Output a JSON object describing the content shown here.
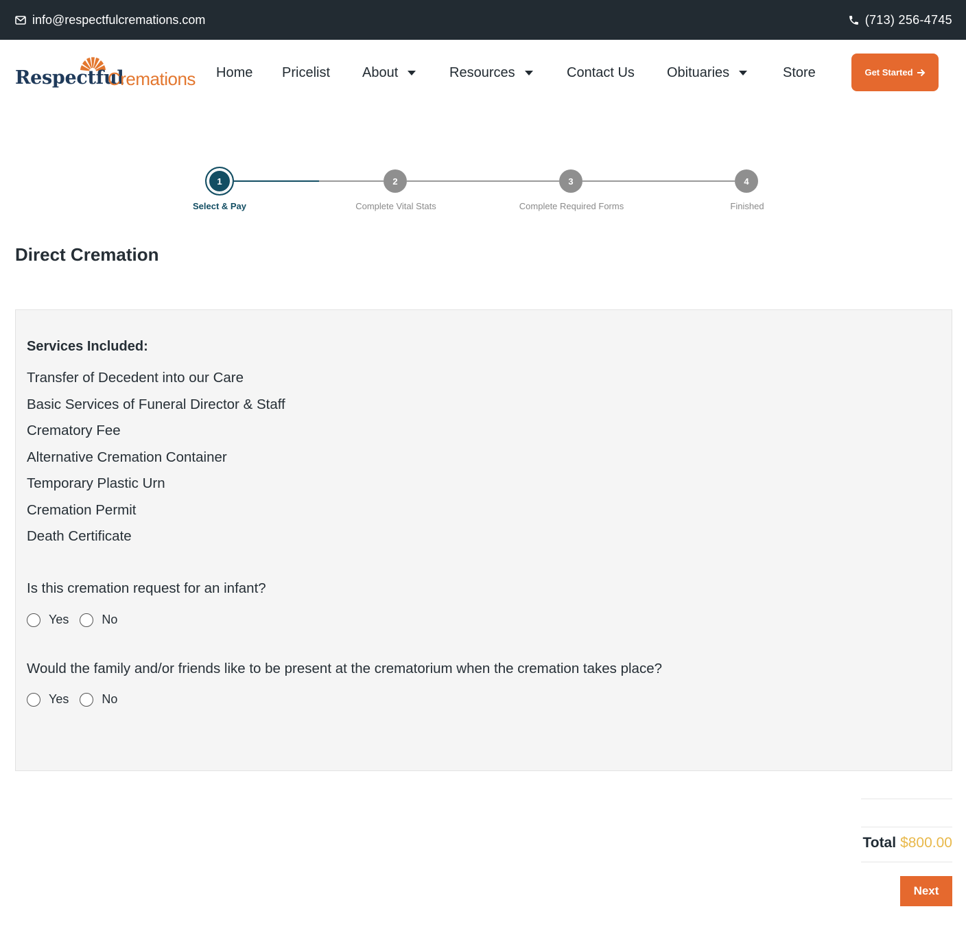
{
  "topbar": {
    "email": "info@respectfulcremations.com",
    "phone": "(713) 256-4745"
  },
  "logo": {
    "word1": "Respectful",
    "word2": "Cremations"
  },
  "nav": {
    "items": [
      {
        "label": "Home"
      },
      {
        "label": "Pricelist"
      },
      {
        "label": "About"
      },
      {
        "label": "Resources"
      },
      {
        "label": "Contact Us"
      },
      {
        "label": "Obituaries"
      },
      {
        "label": "Store"
      }
    ],
    "cta_label": "Get Started"
  },
  "steps": [
    {
      "number": "1",
      "label": "Select & Pay",
      "state": "active"
    },
    {
      "number": "2",
      "label": "Complete Vital Stats",
      "state": "inactive"
    },
    {
      "number": "3",
      "label": "Complete Required Forms",
      "state": "inactive"
    },
    {
      "number": "4",
      "label": "Finished",
      "state": "inactive"
    }
  ],
  "page": {
    "title": "Direct Cremation"
  },
  "services": {
    "heading": "Services Included:",
    "items": [
      "Transfer of Decedent into our Care",
      "Basic Services of Funeral Director & Staff",
      "Crematory Fee",
      "Alternative Cremation Container",
      "Temporary Plastic Urn",
      "Cremation Permit",
      "Death Certificate"
    ]
  },
  "questions": [
    {
      "text": "Is this cremation request for an infant?",
      "options": [
        "Yes",
        "No"
      ]
    },
    {
      "text": "Would the family and/or friends like to be present at the crematorium when the cremation takes place?",
      "options": [
        "Yes",
        "No"
      ]
    }
  ],
  "summary": {
    "total_label": "Total",
    "total_value": "$800.00",
    "next_label": "Next"
  },
  "colors": {
    "topbar_bg": "#222b32",
    "accent_orange": "#e5692e",
    "step_active": "#134e63",
    "step_inactive": "#8f8f8f",
    "total_gold": "#e8b84a",
    "panel_bg": "#f5f5f5"
  }
}
